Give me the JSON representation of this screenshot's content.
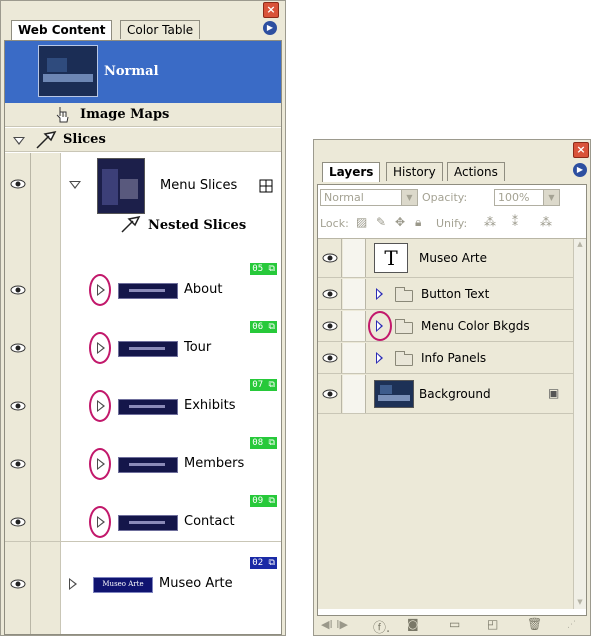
{
  "web_content_panel": {
    "tabs": [
      {
        "label": "Web Content",
        "active": true
      },
      {
        "label": "Color Table",
        "active": false
      }
    ],
    "page_label": "Normal",
    "image_maps_label": "Image Maps",
    "slices_label": "Slices",
    "menu_slices_label": "Menu Slices",
    "nested_slices_label": "Nested Slices",
    "slices": [
      {
        "label": "About",
        "badge": "05"
      },
      {
        "label": "Tour",
        "badge": "06"
      },
      {
        "label": "Exhibits",
        "badge": "07"
      },
      {
        "label": "Members",
        "badge": "08"
      },
      {
        "label": "Contact",
        "badge": "09"
      }
    ],
    "museo_slice": {
      "label": "Museo Arte",
      "badge": "02",
      "thumb_text": "Museo Arte"
    },
    "colors": {
      "selected_row": "#3a6bc6",
      "badge_green": "#27c93a",
      "badge_blue": "#1a2aa6",
      "highlight_circle": "#c2186b"
    }
  },
  "layers_panel": {
    "tabs": [
      {
        "label": "Layers",
        "active": true
      },
      {
        "label": "History",
        "active": false
      },
      {
        "label": "Actions",
        "active": false
      }
    ],
    "blend_mode": "Normal",
    "opacity_label": "Opacity:",
    "opacity_value": "100%",
    "lock_label": "Lock:",
    "unify_label": "Unify:",
    "layers": [
      {
        "name": "Museo Arte",
        "kind": "text",
        "thumb_glyph": "T"
      },
      {
        "name": "Button Text",
        "kind": "group"
      },
      {
        "name": "Menu Color Bkgds",
        "kind": "group"
      },
      {
        "name": "Info Panels",
        "kind": "group"
      },
      {
        "name": "Background",
        "kind": "image",
        "locked": true
      }
    ],
    "icons": [
      "animation-frames-icon",
      "layer-style-icon",
      "layer-mask-icon",
      "new-group-icon",
      "new-layer-icon",
      "trash-icon"
    ]
  }
}
